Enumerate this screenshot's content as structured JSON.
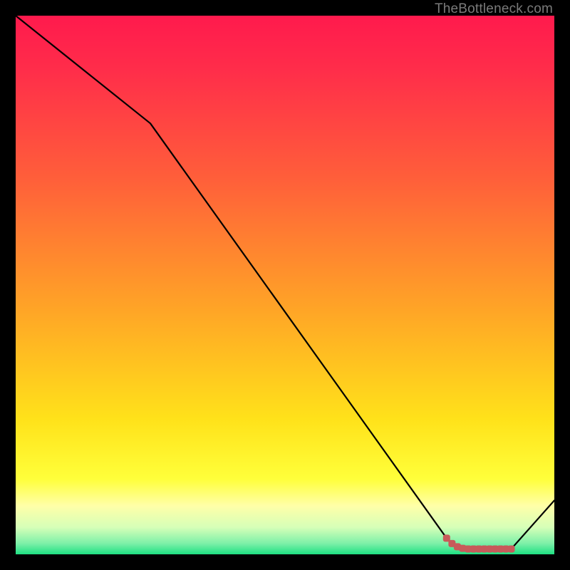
{
  "watermark": "TheBottleneck.com",
  "colors": {
    "gradient": {
      "c0": "#ff1a4d",
      "c1": "#ff2d4a",
      "c2": "#ff5e3a",
      "c3": "#ffa626",
      "c4": "#ffe21a",
      "c5": "#ffff3a",
      "c6": "#ffffa8",
      "c7": "#d6ffb8",
      "c8": "#7cf0a8",
      "c9": "#1ee082"
    },
    "line": "#000000",
    "marker_fill": "#c85a5a",
    "marker_stroke": "#c85a5a"
  },
  "chart_data": {
    "type": "line",
    "title": "",
    "xlabel": "",
    "ylabel": "",
    "xlim": [
      0,
      100
    ],
    "ylim": [
      0,
      100
    ],
    "series": [
      {
        "name": "bottleneck-curve",
        "x": [
          0,
          25,
          80,
          82,
          92,
          100
        ],
        "y": [
          100,
          80,
          3,
          1,
          1,
          10
        ]
      }
    ],
    "markers": {
      "name": "highlight-segment",
      "x": [
        80,
        81,
        82,
        83,
        84,
        85,
        86,
        87,
        88,
        89,
        90,
        91,
        92
      ],
      "y": [
        3,
        2,
        1.4,
        1.1,
        1,
        1,
        1,
        1,
        1,
        1,
        1,
        1,
        1
      ]
    }
  }
}
